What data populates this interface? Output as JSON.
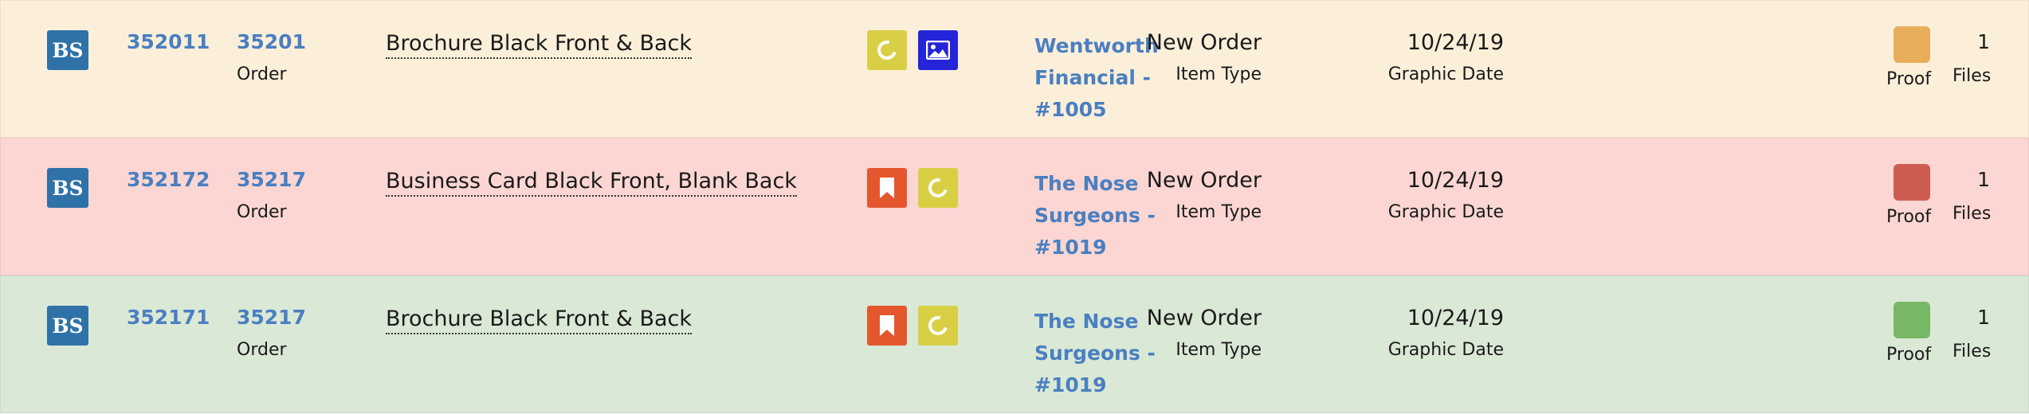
{
  "rows": [
    {
      "bg": "#fcefd9",
      "badge": "BS",
      "job_id": "352011",
      "order_id": "35201",
      "order_label": "Order",
      "description": "Brochure Black Front & Back",
      "icons": [
        {
          "name": "sync-icon",
          "color": "#d9cf45"
        },
        {
          "name": "image-icon",
          "color": "#2424d8"
        }
      ],
      "customer": "Wentworth Financial - #1005",
      "status": "New Order",
      "status_label": "Item Type",
      "date": "10/24/19",
      "date_label": "Graphic Date",
      "proof_color": "#e8ae5c",
      "proof_label": "Proof",
      "files_count": "1",
      "files_label": "Files"
    },
    {
      "bg": "#fbd6d2",
      "badge": "BS",
      "job_id": "352172",
      "order_id": "35217",
      "order_label": "Order",
      "description": "Business Card Black Front, Blank Back",
      "icons": [
        {
          "name": "bookmark-icon",
          "color": "#e4572e"
        },
        {
          "name": "sync-icon",
          "color": "#d9cf45"
        }
      ],
      "customer": "The Nose Surgeons - #1019",
      "status": "New Order",
      "status_label": "Item Type",
      "date": "10/24/19",
      "date_label": "Graphic Date",
      "proof_color": "#cd5c50",
      "proof_label": "Proof",
      "files_count": "1",
      "files_label": "Files"
    },
    {
      "bg": "#dae8d6",
      "badge": "BS",
      "job_id": "352171",
      "order_id": "35217",
      "order_label": "Order",
      "description": "Brochure Black Front & Back",
      "icons": [
        {
          "name": "bookmark-icon",
          "color": "#e4572e"
        },
        {
          "name": "sync-icon",
          "color": "#d9cf45"
        }
      ],
      "customer": "The Nose Surgeons - #1019",
      "status": "New Order",
      "status_label": "Item Type",
      "date": "10/24/19",
      "date_label": "Graphic Date",
      "proof_color": "#78b866",
      "proof_label": "Proof",
      "files_count": "1",
      "files_label": "Files"
    }
  ]
}
